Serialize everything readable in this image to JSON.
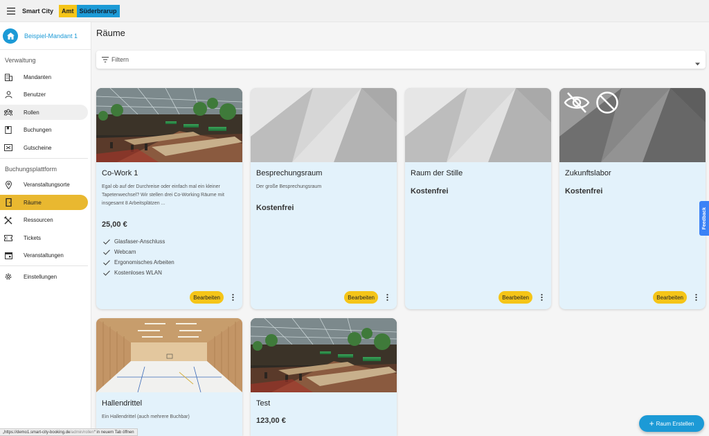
{
  "topbar": {
    "brand": "Smart City",
    "badge_amt": "Amt",
    "badge_town": "Süderbrarup"
  },
  "sidebar": {
    "tenant": "Beispiel-Mandant 1",
    "sections": [
      {
        "label": "Verwaltung",
        "items": [
          "Mandanten",
          "Benutzer",
          "Rollen",
          "Buchungen",
          "Gutscheine"
        ]
      },
      {
        "label": "Buchungsplattform",
        "items": [
          "Veranstaltungsorte",
          "Räume",
          "Ressourcen",
          "Tickets",
          "Veranstaltungen"
        ]
      }
    ],
    "settings": "Einstellungen",
    "active": "Räume",
    "hovered": "Rollen"
  },
  "main": {
    "title": "Räume",
    "filter_label": "Filtern",
    "edit_label": "Bearbeiten",
    "cards": [
      {
        "title": "Co-Work 1",
        "description": "Egal ob auf der Durchreise oder einfach mal ein kleiner Tapetenwechsel? Wir stellen drei Co-Working Räume mit insgesamt 8 Arbeitsplätzen ...",
        "price": "25,00 €",
        "features": [
          "Glasfaser-Anschluss",
          "Webcam",
          "Ergonomisches Arbeiten",
          "Kostenloses WLAN"
        ],
        "image": "cowork-photo"
      },
      {
        "title": "Besprechungsraum",
        "description": "Der große Besprechungsraum",
        "price": "Kostenfrei",
        "features": [],
        "image": "placeholder-geometric"
      },
      {
        "title": "Raum der Stille",
        "description": "",
        "price": "Kostenfrei",
        "features": [],
        "image": "placeholder-geometric"
      },
      {
        "title": "Zukunftslabor",
        "description": "",
        "price": "Kostenfrei",
        "features": [],
        "image": "placeholder-geometric-hidden",
        "status_icons": [
          "eye-off-icon",
          "block-icon"
        ]
      },
      {
        "title": "Hallendrittel",
        "description": "Ein Hallendrittel (auch mehrere Buchbar)",
        "price": "",
        "features": [],
        "image": "sports-hall-photo"
      },
      {
        "title": "Test",
        "description": "",
        "price": "123,00 €",
        "features": [],
        "image": "cowork-photo"
      }
    ]
  },
  "feedback_label": "Feedback",
  "fab_label": "Raum Erstellen",
  "statusbar": {
    "url": "„https://demo1.smart-city-booking.de",
    "path": "/admin/rollen",
    "suffix": "“ in neuem Tab öffnen"
  },
  "colors": {
    "accent_yellow": "#f5c518",
    "accent_blue": "#1c9ad6",
    "card_bg": "#e3f2fb",
    "active_nav": "#e9b830"
  }
}
